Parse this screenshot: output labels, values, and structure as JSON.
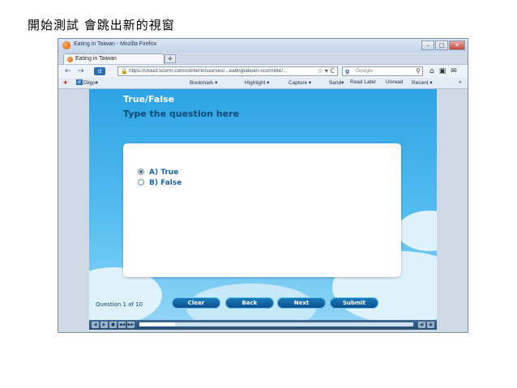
{
  "slide": {
    "title": "開始測試 會跳出新的視窗"
  },
  "browser": {
    "window_title": "Eating in Taiwan - Mozilla Firefox",
    "window_buttons": {
      "minimize": "–",
      "maximize": "□",
      "close": "✕"
    },
    "tab": {
      "label": "Eating in Taiwan",
      "new_tab": "+"
    },
    "nav": {
      "back": "←",
      "forward": "→",
      "home": "⌂"
    },
    "url": "https://cloud.scorm.com/content/courses/...eatingtaiwan-scormlite/...",
    "url_tools": "☆ ▾ C",
    "search": {
      "engine": "g",
      "placeholder": "Google"
    },
    "nav_icons": [
      "⌂",
      "▣",
      "✉"
    ],
    "bookmarks": [
      "Diigo▾",
      "Bookmark ▾",
      "Highlight ▾",
      "Capture ▾",
      "Send▾",
      "Read Later",
      "Unread",
      "Recent ▾",
      "»"
    ]
  },
  "quiz": {
    "type": "True/False",
    "question": "Type the question here",
    "choices": [
      {
        "label": "A) True",
        "selected": true
      },
      {
        "label": "B) False",
        "selected": false
      }
    ],
    "counter": "Question 1 of 10",
    "buttons": {
      "clear": "Clear",
      "back": "Back",
      "next": "Next",
      "submit": "Submit"
    }
  },
  "player": {
    "buttons": [
      "◀",
      "▶",
      "■",
      "◀◀",
      "▶▶"
    ],
    "volume": "◀)",
    "fullscreen": "▣",
    "progress": 0.13
  },
  "colors": {
    "sky_top": "#2ea3e3",
    "button_blue": "#0a4d88",
    "question_text": "#0a4a75",
    "choice_text": "#1a63a8"
  }
}
